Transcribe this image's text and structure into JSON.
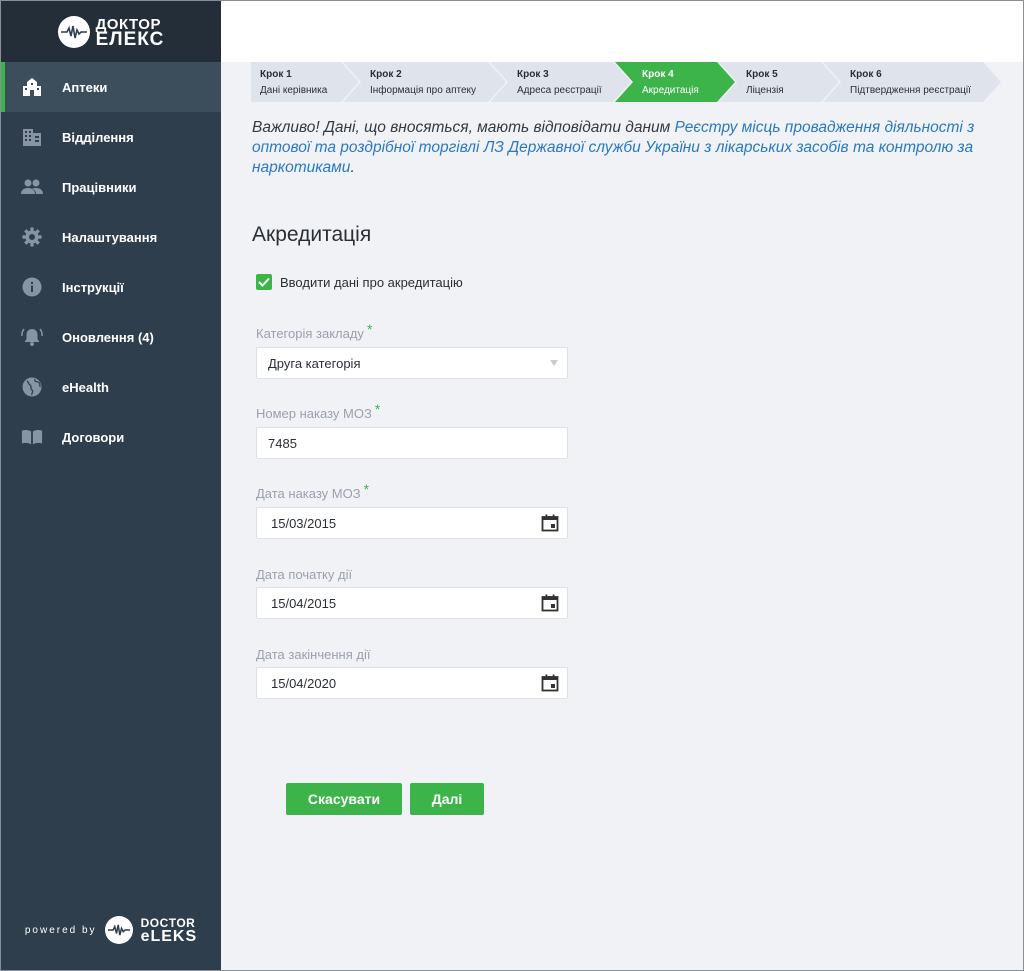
{
  "brand": {
    "line1": "ДОКТОР",
    "line2": "ЕЛЕКС"
  },
  "sidebar": {
    "items": [
      {
        "label": "Аптеки",
        "icon": "building-icon"
      },
      {
        "label": "Відділення",
        "icon": "office-building-icon"
      },
      {
        "label": "Працівники",
        "icon": "people-icon"
      },
      {
        "label": "Налаштування",
        "icon": "gear-icon"
      },
      {
        "label": "Інструкції",
        "icon": "info-icon"
      },
      {
        "label": "Оновлення (4)",
        "icon": "bell-icon"
      },
      {
        "label": "eHealth",
        "icon": "globe-icon"
      },
      {
        "label": "Договори",
        "icon": "book-icon"
      }
    ],
    "active_index": 0
  },
  "powered_by": {
    "label": "powered by",
    "line1": "DOCTOR",
    "line2": "eLEKS"
  },
  "stepper": {
    "steps": [
      {
        "num": "Крок 1",
        "title": "Дані керівника"
      },
      {
        "num": "Крок 2",
        "title": "Інформація про аптеку"
      },
      {
        "num": "Крок 3",
        "title": "Адреса реєстрації"
      },
      {
        "num": "Крок 4",
        "title": "Акредитація"
      },
      {
        "num": "Крок 5",
        "title": "Ліцензія"
      },
      {
        "num": "Крок 6",
        "title": "Підтвердження реєстрації"
      }
    ],
    "active_index": 3
  },
  "notice": {
    "prefix": "Важливо! Дані, що вносяться, мають відповідати даним ",
    "link": "Реєстру місць провадження діяльності з оптової та роздрібної торгівлі ЛЗ Державної служби України з лікарських засобів та контролю за наркотиками",
    "suffix": "."
  },
  "form": {
    "title": "Акредитація",
    "checkbox_label": "Вводити дані про акредитацію",
    "checkbox_checked": true,
    "category": {
      "label": "Категорія закладу",
      "value": "Друга категорія",
      "required": "*"
    },
    "order_number": {
      "label": "Номер наказу МОЗ",
      "value": "7485",
      "required": "*"
    },
    "order_date": {
      "label": "Дата наказу МОЗ",
      "value": "15/03/2015",
      "required": "*"
    },
    "start_date": {
      "label": "Дата початку дії",
      "value": "15/04/2015"
    },
    "end_date": {
      "label": "Дата закінчення дії",
      "value": "15/04/2020"
    },
    "cancel_label": "Скасувати",
    "next_label": "Далі"
  },
  "colors": {
    "accent": "#3db449",
    "sidebar": "#2f3e4c",
    "link": "#2a79c2"
  }
}
